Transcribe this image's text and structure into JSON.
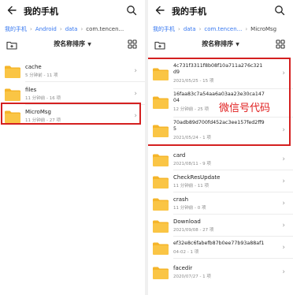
{
  "left": {
    "title": "我的手机",
    "breadcrumbs": [
      "我的手机",
      "Android",
      "data",
      "com.tencen..."
    ],
    "sort_label": "按名称排序",
    "folders": [
      {
        "name": "cache",
        "meta": "5 分钟前 - 11 项"
      },
      {
        "name": "files",
        "meta": "11 分钟前 - 16 项"
      },
      {
        "name": "MicroMsg",
        "meta": "11 分钟前 - 27 项"
      }
    ]
  },
  "right": {
    "title": "我的手机",
    "breadcrumbs": [
      "我的手机",
      "data",
      "com.tencen...",
      "MicroMsg"
    ],
    "sort_label": "按名称排序",
    "folders": [
      {
        "name1": "4c731f3311f8b08f10a711a276c321",
        "name2": "d9",
        "meta": "2021/05/25 - 15 项"
      },
      {
        "name1": "16faa83c7a54aa6a03aa23e30ca147",
        "name2": "04",
        "meta": "12 分钟前 - 25 项"
      },
      {
        "name1": "70adb89d700fd452ac3ee157fed2ff9",
        "name2": "5",
        "meta": "2021/05/24 - 1 项"
      },
      {
        "name": "card",
        "meta": "2021/08/11 - 9 项"
      },
      {
        "name": "CheckResUpdate",
        "meta": "11 分钟前 - 11 项"
      },
      {
        "name": "crash",
        "meta": "11 分钟前 - 0 项"
      },
      {
        "name": "Download",
        "meta": "2021/09/08 - 27 项"
      },
      {
        "name": "ef32e8c6fabefb87b0ee77b93a88af1",
        "meta": "04-02 - 1 项"
      },
      {
        "name": "facedir",
        "meta": "2020/07/27 - 1 项"
      }
    ],
    "annotation": "微信号代码"
  },
  "colors": {
    "accent": "#3677f0",
    "folder": "#f5b52a",
    "highlight": "#d42020"
  }
}
